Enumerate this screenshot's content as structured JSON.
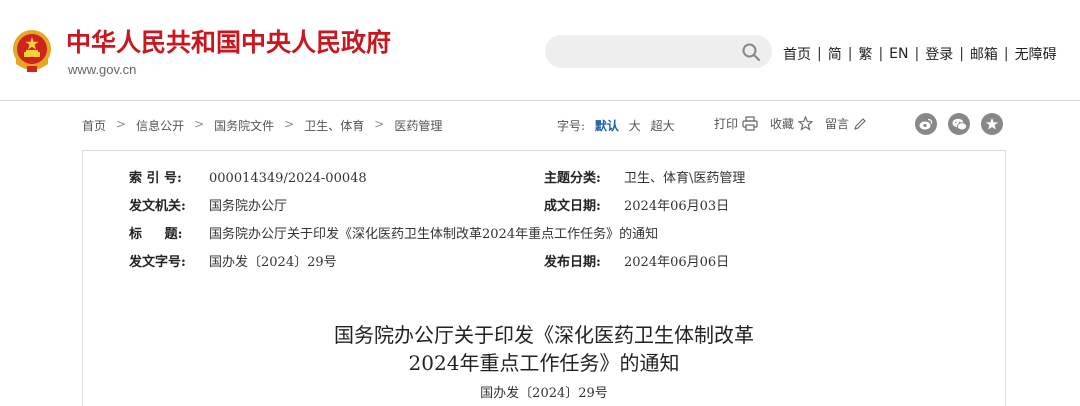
{
  "header": {
    "site_title": "中华人民共和国中央人民政府",
    "site_url": "www.gov.cn",
    "search_placeholder": "",
    "nav": [
      "首页",
      "简",
      "繁",
      "EN",
      "登录",
      "邮箱",
      "无障碍"
    ]
  },
  "breadcrumb": [
    "首页",
    "信息公开",
    "国务院文件",
    "卫生、体育",
    "医药管理"
  ],
  "font_size": {
    "label": "字号:",
    "options": [
      "默认",
      "大",
      "超大"
    ],
    "selected": "默认"
  },
  "tools": {
    "print": "打印",
    "favorite": "收藏",
    "comment": "留言"
  },
  "social": [
    "weibo-icon",
    "wechat-icon",
    "star-icon"
  ],
  "meta": {
    "index_no_label": "索 引 号:",
    "index_no": "000014349/2024-00048",
    "category_label": "主题分类:",
    "category": "卫生、体育\\医药管理",
    "issuer_label": "发文机关:",
    "issuer": "国务院办公厅",
    "date_written_label": "成文日期:",
    "date_written": "2024年06月03日",
    "title_label": "标     题:",
    "title": "国务院办公厅关于印发《深化医药卫生体制改革2024年重点工作任务》的通知",
    "doc_no_label": "发文字号:",
    "doc_no": "国办发〔2024〕29号",
    "publish_date_label": "发布日期:",
    "publish_date": "2024年06月06日"
  },
  "article": {
    "title_line1": "国务院办公厅关于印发《深化医药卫生体制改革",
    "title_line2": "2024年重点工作任务》的通知",
    "doc_no": "国办发〔2024〕29号"
  },
  "colors": {
    "brand_red": "#c8171e",
    "link_blue": "#1c5fa8"
  }
}
